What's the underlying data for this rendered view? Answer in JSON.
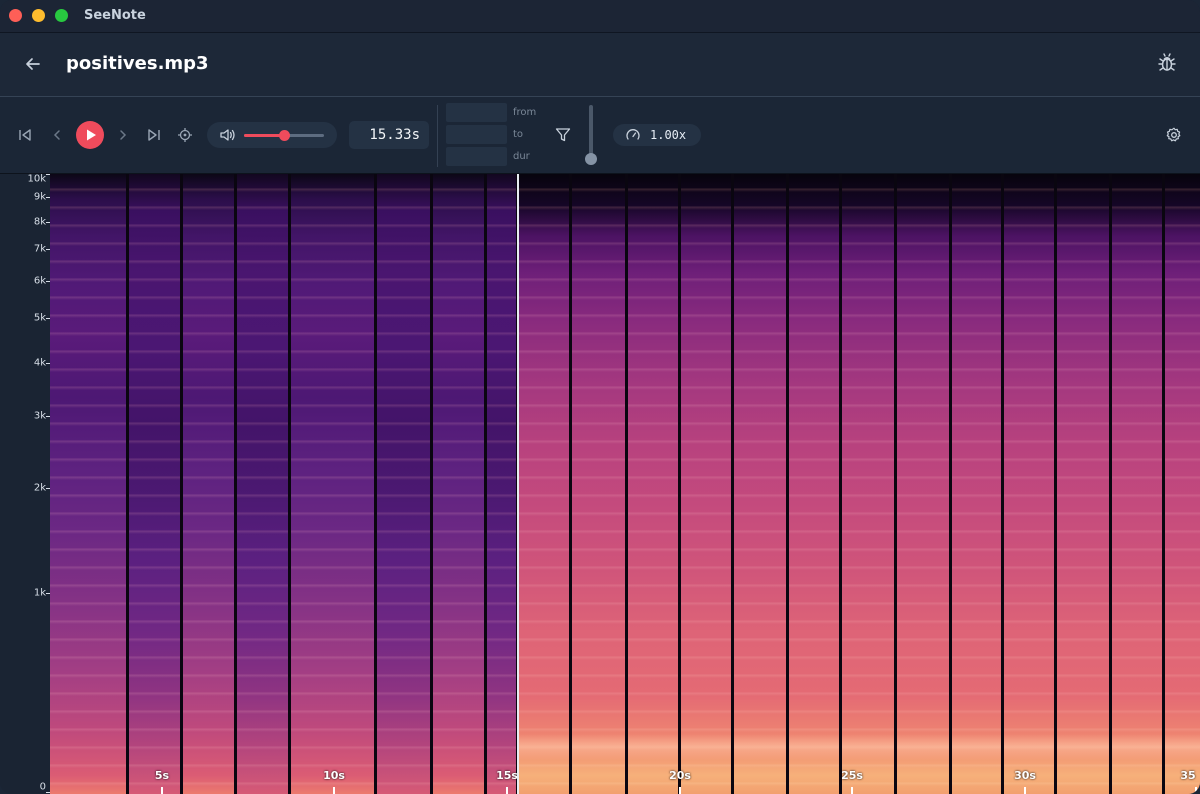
{
  "app": {
    "title": "SeeNote"
  },
  "header": {
    "file_name": "positives.mp3"
  },
  "toolbar": {
    "time": "15.33s",
    "from_label": "from",
    "to_label": "to",
    "dur_label": "dur",
    "from_value": "",
    "to_value": "",
    "dur_value": "",
    "speed": "1.00x",
    "volume_fraction": 0.5,
    "accent_color": "#ef4b5c"
  },
  "spectrogram": {
    "y_ticks": [
      "10k",
      "9k",
      "8k",
      "7k",
      "6k",
      "5k",
      "4k",
      "3k",
      "2k",
      "1k",
      "0"
    ],
    "x_ticks": [
      "5s",
      "10s",
      "15s",
      "20s",
      "25s",
      "30s",
      "35"
    ],
    "playhead_time": "15.33s"
  },
  "icons": {
    "back": "arrow-left-icon",
    "bug": "bug-icon",
    "skip_start": "skip-start-icon",
    "prev": "chevron-left-icon",
    "play": "play-icon",
    "next": "chevron-right-icon",
    "skip_end": "skip-end-icon",
    "locate": "crosshair-icon",
    "volume": "volume-icon",
    "filter": "filter-icon",
    "speed": "gauge-icon",
    "settings": "gear-icon"
  }
}
